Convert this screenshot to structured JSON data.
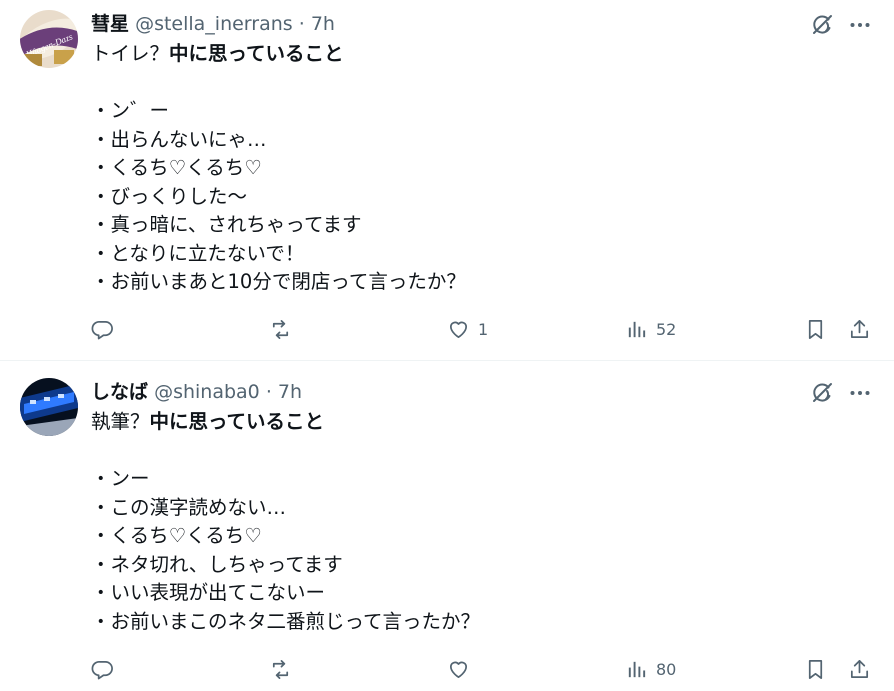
{
  "tweets": [
    {
      "name": "彗星",
      "handle": "@stella_inerrans",
      "separator": "·",
      "time": "7h",
      "line1_plain": "トイレ？",
      "line1_bold": "中に思っていること",
      "items": [
        "・ン゛ー",
        "・出らんないにゃ…",
        "・くるち♡くるち♡",
        "・びっくりした〜",
        "・真っ暗に、されちゃってます",
        "・となりに立たないで！",
        "・お前いまあと10分で閉店って言ったか？"
      ],
      "replies": "",
      "reposts": "",
      "likes": "1",
      "views": "52"
    },
    {
      "name": "しなば",
      "handle": "@shinaba0",
      "separator": "·",
      "time": "7h",
      "line1_plain": "執筆？",
      "line1_bold": "中に思っていること",
      "items": [
        "・ンー",
        "・この漢字読めない…",
        "・くるち♡くるち♡",
        "・ネタ切れ、しちゃってます",
        "・いい表現が出てこないー",
        "・お前いまこのネタ二番煎じって言ったか？"
      ],
      "replies": "",
      "reposts": "",
      "likes": "",
      "views": "80"
    }
  ],
  "icons": {
    "reply": "reply-icon",
    "repost": "repost-icon",
    "like": "heart-icon",
    "views": "views-icon",
    "bookmark": "bookmark-icon",
    "share": "share-icon",
    "grok": "grok-icon",
    "more": "more-icon"
  },
  "colors": {
    "text": "#0f1419",
    "secondary": "#536471",
    "divider": "#eff3f4"
  }
}
